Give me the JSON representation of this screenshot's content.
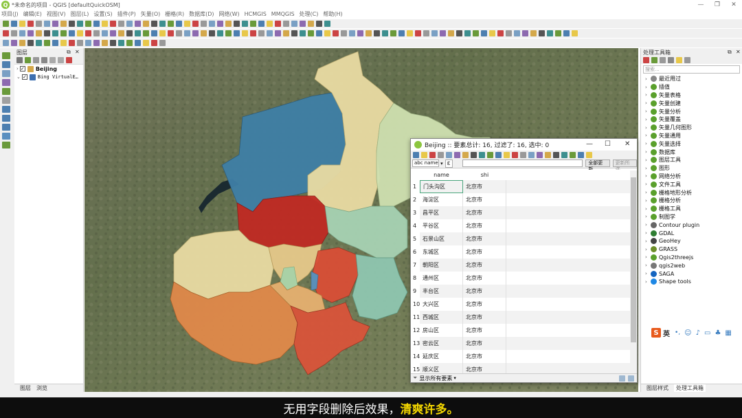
{
  "window": {
    "title": "*未命名的项目 - QGIS [defaultQuickOSM]"
  },
  "menu": [
    "项目(J)",
    "编辑(E)",
    "视图(V)",
    "图层(L)",
    "设置(S)",
    "插件(P)",
    "矢量(O)",
    "栅格(R)",
    "数据库(D)",
    "网络(W)",
    "HCMGIS",
    "MMQGIS",
    "处理(C)",
    "帮助(H)"
  ],
  "layers_panel": {
    "title": "图层",
    "tabs": [
      "图层",
      "浏览"
    ],
    "layers": [
      {
        "name": "Beijing",
        "checked": true
      },
      {
        "name": "Bing VirtualE…",
        "checked": true
      }
    ]
  },
  "attribute_table": {
    "title": "Beijing :: 要素总计: 16, 过滤了: 16, 选中: 0",
    "field_selector": "abc name",
    "update_all_label": "全部更新",
    "update_selected_label": "更新所选",
    "columns": [
      "name",
      "shi"
    ],
    "rows": [
      {
        "num": "1",
        "name": "门头沟区",
        "shi": "北京市"
      },
      {
        "num": "2",
        "name": "海淀区",
        "shi": "北京市"
      },
      {
        "num": "3",
        "name": "昌平区",
        "shi": "北京市"
      },
      {
        "num": "4",
        "name": "平谷区",
        "shi": "北京市"
      },
      {
        "num": "5",
        "name": "石景山区",
        "shi": "北京市"
      },
      {
        "num": "6",
        "name": "东城区",
        "shi": "北京市"
      },
      {
        "num": "7",
        "name": "朝阳区",
        "shi": "北京市"
      },
      {
        "num": "8",
        "name": "通州区",
        "shi": "北京市"
      },
      {
        "num": "9",
        "name": "丰台区",
        "shi": "北京市"
      },
      {
        "num": "10",
        "name": "大兴区",
        "shi": "北京市"
      },
      {
        "num": "11",
        "name": "西城区",
        "shi": "北京市"
      },
      {
        "num": "12",
        "name": "房山区",
        "shi": "北京市"
      },
      {
        "num": "13",
        "name": "密云区",
        "shi": "北京市"
      },
      {
        "num": "14",
        "name": "延庆区",
        "shi": "北京市"
      },
      {
        "num": "15",
        "name": "顺义区",
        "shi": "北京市"
      }
    ],
    "footer_filter": "显示所有要素"
  },
  "toolbox": {
    "title": "处理工具箱",
    "search_placeholder": "搜索...",
    "tabs": [
      "图层样式",
      "处理工具箱"
    ],
    "items": [
      {
        "label": "最近用过",
        "icon": "clock-icon",
        "color": "#888888"
      },
      {
        "label": "插值",
        "icon": "qgis-icon",
        "color": "#5aa02c"
      },
      {
        "label": "矢量表格",
        "icon": "qgis-icon",
        "color": "#5aa02c"
      },
      {
        "label": "矢量创建",
        "icon": "qgis-icon",
        "color": "#5aa02c"
      },
      {
        "label": "矢量分析",
        "icon": "qgis-icon",
        "color": "#5aa02c"
      },
      {
        "label": "矢量覆盖",
        "icon": "qgis-icon",
        "color": "#5aa02c"
      },
      {
        "label": "矢量几何图形",
        "icon": "qgis-icon",
        "color": "#5aa02c"
      },
      {
        "label": "矢量通用",
        "icon": "qgis-icon",
        "color": "#5aa02c"
      },
      {
        "label": "矢量选择",
        "icon": "qgis-icon",
        "color": "#5aa02c"
      },
      {
        "label": "数据库",
        "icon": "qgis-icon",
        "color": "#5aa02c"
      },
      {
        "label": "图层工具",
        "icon": "qgis-icon",
        "color": "#5aa02c"
      },
      {
        "label": "图形",
        "icon": "qgis-icon",
        "color": "#5aa02c"
      },
      {
        "label": "网络分析",
        "icon": "qgis-icon",
        "color": "#5aa02c"
      },
      {
        "label": "文件工具",
        "icon": "qgis-icon",
        "color": "#5aa02c"
      },
      {
        "label": "栅格地形分析",
        "icon": "qgis-icon",
        "color": "#5aa02c"
      },
      {
        "label": "栅格分析",
        "icon": "qgis-icon",
        "color": "#5aa02c"
      },
      {
        "label": "栅格工具",
        "icon": "qgis-icon",
        "color": "#5aa02c"
      },
      {
        "label": "制图学",
        "icon": "qgis-icon",
        "color": "#5aa02c"
      },
      {
        "label": "Contour plugin",
        "icon": "contour-icon",
        "color": "#666666"
      },
      {
        "label": "GDAL",
        "icon": "gdal-icon",
        "color": "#2e7d32"
      },
      {
        "label": "GeoHey",
        "icon": "geohey-icon",
        "color": "#444444"
      },
      {
        "label": "GRASS",
        "icon": "grass-icon",
        "color": "#6d8f2a"
      },
      {
        "label": "Qgis2threejs",
        "icon": "qgis-icon",
        "color": "#5aa02c"
      },
      {
        "label": "qgis2web",
        "icon": "gear-icon",
        "color": "#777777"
      },
      {
        "label": "SAGA",
        "icon": "saga-icon",
        "color": "#1565c0"
      },
      {
        "label": "Shape tools",
        "icon": "star-icon",
        "color": "#1e88e5"
      }
    ]
  },
  "subtitle": {
    "plain": "无用字段删除后效果，",
    "highlight": "清爽许多。"
  },
  "colors": {
    "district_blue": "#3f7fa6",
    "district_red": "#c02a23",
    "district_orange": "#e0894a",
    "district_light_yellow": "#e9dba3",
    "district_light_green": "#cfe0b0",
    "district_mint": "#a7d2b3",
    "subtitle_highlight": "#f5d800"
  }
}
